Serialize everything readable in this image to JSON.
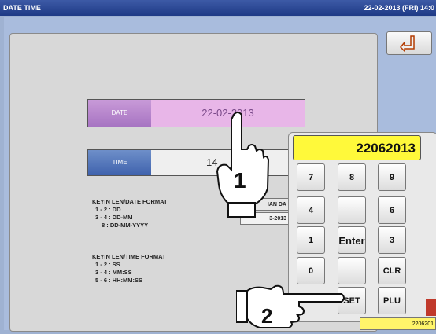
{
  "titlebar": {
    "title": "DATE TIME",
    "datetime": "22-02-2013 (FRI) 14:0"
  },
  "date_field": {
    "label": "DATE",
    "value": "22-02-2013"
  },
  "time_field": {
    "label": "TIME",
    "value": "14"
  },
  "date_format": {
    "heading": "KEYIN LEN/DATE FORMAT",
    "lines": [
      "1 - 2 : DD",
      "3 - 4 : DD-MM",
      "8 : DD-MM-YYYY"
    ]
  },
  "time_format": {
    "heading": "KEYIN LEN/TIME FORMAT",
    "lines": [
      "1 - 2 : SS",
      "3 - 4 : MM:SS",
      "5 - 6 : HH:MM:SS"
    ]
  },
  "obscured": {
    "label_fragment": "IAN DA",
    "value_fragment": "3-2013"
  },
  "keypad": {
    "display": "22062013",
    "keys": [
      "7",
      "8",
      "9",
      "4",
      "",
      "6",
      "1",
      "Enter",
      "3",
      "0",
      "",
      "CLR",
      "SET",
      "PLU"
    ]
  },
  "callouts": {
    "step1": "1",
    "step2": "2"
  },
  "footer": {
    "value": "2206201"
  },
  "icons": {
    "back": "back-arrow-icon",
    "hand": "pointing-hand-icon"
  }
}
